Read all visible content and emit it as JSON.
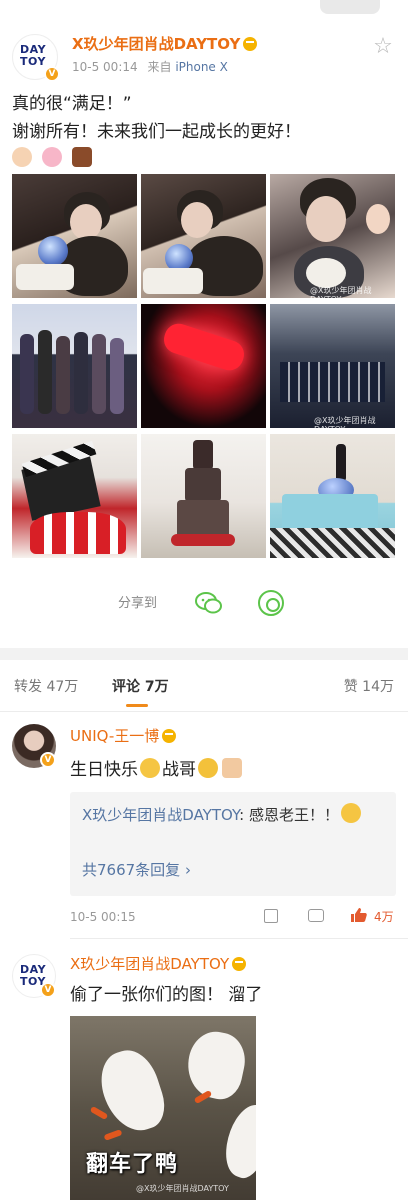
{
  "post": {
    "author": "X玖少年团肖战DAYTOY",
    "avatar_logo": "DAY TOY",
    "time": "10-5 00:14",
    "source_prefix": "来自",
    "source": "iPhone X",
    "text_line1": "真的很“满足！”",
    "text_line2": "谢谢所有！未来我们一起成长的更好！",
    "emojis": [
      "pray-emoji",
      "pig-emoji",
      "cake-emoji"
    ],
    "photos": [
      "photo-1",
      "photo-2",
      "photo-3",
      "photo-4",
      "photo-5",
      "photo-6",
      "photo-7",
      "photo-8",
      "photo-9"
    ],
    "photo_watermark": "@X玖少年团肖战DAYTOY"
  },
  "share": {
    "label": "分享到",
    "targets": [
      "wechat-icon",
      "moments-icon"
    ]
  },
  "tabs": {
    "repost": "转发 47万",
    "comments": "评论 7万",
    "likes": "赞 14万"
  },
  "comments": [
    {
      "author": "UNIQ-王一博",
      "text_part1": "生日快乐",
      "text_part2": "战哥",
      "reply": {
        "author": "X玖少年团肖战DAYTOY",
        "text": ": 感恩老王！！",
        "more": "共7667条回复",
        "more_arrow": "›"
      },
      "time": "10-5 00:15",
      "likes": "4万"
    },
    {
      "author": "X玖少年团肖战DAYTOY",
      "text": "偷了一张你们的图！ 溜了",
      "image_caption": "翻车了鸭",
      "image_watermark": "@X玖少年团肖战DAYTOY"
    }
  ],
  "colors": {
    "author": "#ea6e14",
    "link": "#5676a3",
    "accent": "#f08a1a",
    "like": "#e35a2f"
  }
}
